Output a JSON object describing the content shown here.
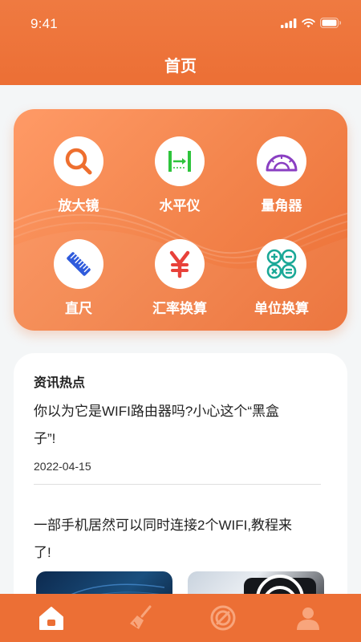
{
  "status_bar": {
    "time": "9:41"
  },
  "header": {
    "title": "首页"
  },
  "tools": [
    {
      "label": "放大镜",
      "icon": "magnifier-icon"
    },
    {
      "label": "水平仪",
      "icon": "level-icon"
    },
    {
      "label": "量角器",
      "icon": "protractor-icon"
    },
    {
      "label": "直尺",
      "icon": "ruler-icon"
    },
    {
      "label": "汇率换算",
      "icon": "yuan-icon"
    },
    {
      "label": "单位换算",
      "icon": "calculator-icon"
    }
  ],
  "news": {
    "heading": "资讯热点",
    "items": [
      {
        "title_line1": "你以为它是WIFI路由器吗?小心这个“黑盒",
        "title_line2": "子”!",
        "date": "2022-04-15"
      },
      {
        "title_line1": "一部手机居然可以同时连接2个WIFI,教程来",
        "title_line2": "了!"
      }
    ]
  },
  "tab_bar": {
    "tabs": [
      {
        "icon": "home-icon",
        "active": true
      },
      {
        "icon": "clean-brush-icon",
        "active": false
      },
      {
        "icon": "speed-test-icon",
        "active": false
      },
      {
        "icon": "profile-icon",
        "active": false
      }
    ]
  },
  "colors": {
    "accent": "#ec6f35",
    "card_gradient_start": "#ff9a66",
    "icon_orange": "#ee6f2f",
    "icon_green": "#2ec43c",
    "icon_purple": "#8a3fc2",
    "icon_blue": "#2f5bdc",
    "icon_red": "#e8413a",
    "icon_teal": "#1aa897"
  }
}
